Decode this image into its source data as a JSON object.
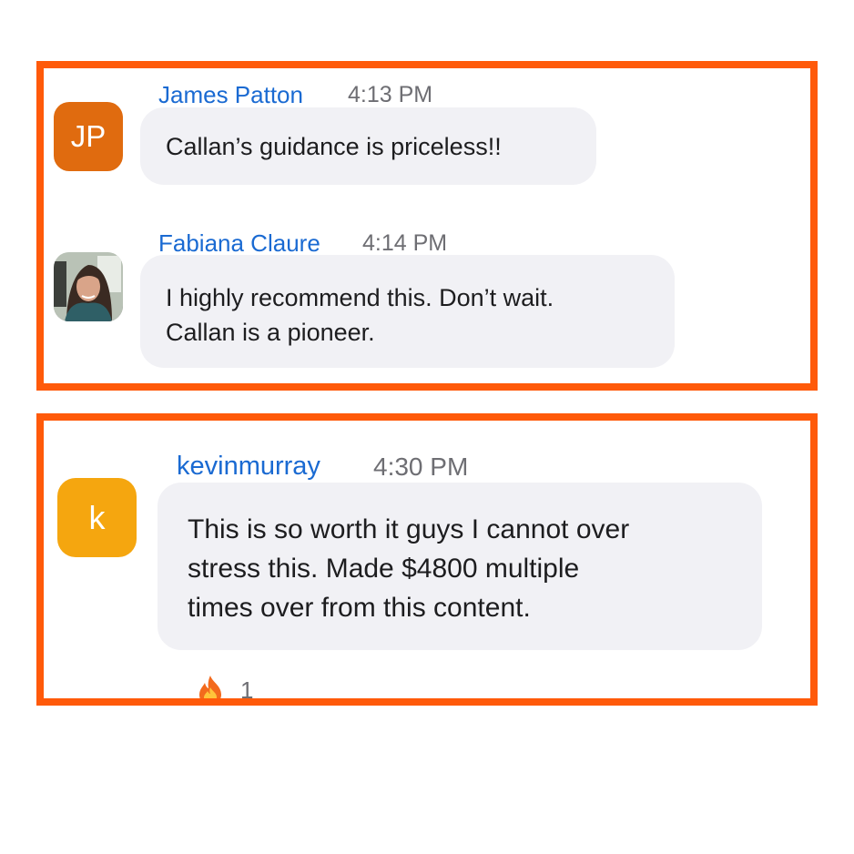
{
  "messages": [
    {
      "sender": "James Patton",
      "time": "4:13 PM",
      "avatar_initials": "JP",
      "avatar_color": "#e06b0f",
      "text": "Callan’s guidance is priceless!!"
    },
    {
      "sender": "Fabiana Claure",
      "time": "4:14 PM",
      "avatar_type": "photo",
      "text": "I highly recommend this. Don’t wait.\nCallan is a pioneer."
    },
    {
      "sender": "kevinmurray",
      "time": "4:30 PM",
      "avatar_initials": "k",
      "avatar_color": "#f5a60f",
      "text": "This is so worth it guys I cannot over\nstress this. Made $4800 multiple\ntimes over from this content.",
      "reaction": {
        "icon": "fire-icon",
        "count": "1"
      }
    }
  ],
  "colors": {
    "highlight_border": "#ff5a0a",
    "sender_name": "#1a6ad2",
    "bubble": "#f1f1f5",
    "timestamp": "#6e6e73"
  }
}
